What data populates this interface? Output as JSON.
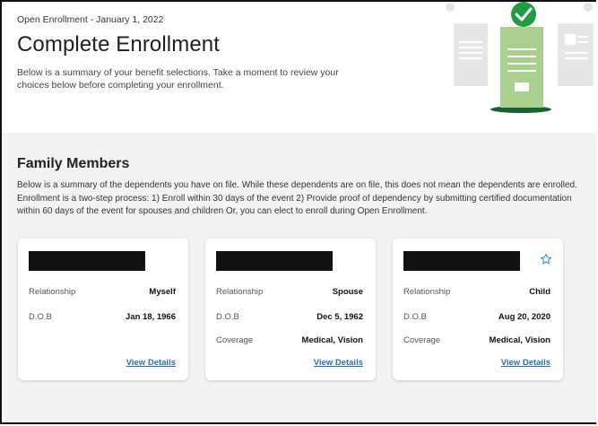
{
  "header": {
    "eyebrow": "Open Enrollment - January 1, 2022",
    "title": "Complete Enrollment",
    "intro": "Below is a summary of your benefit selections. Take a moment to review your choices below before completing your enrollment."
  },
  "family": {
    "title": "Family Members",
    "desc_lines": [
      "Below is a summary of the dependents you have on file. While these dependents are on file, this does not mean the dependents are enrolled.",
      "Enrollment is a two-step process: 1) Enroll within 30 days of the event 2) Provide proof of dependency by submitting certified documentation",
      "within 60 days of the event for spouses and children Or, you can elect to enroll during Open Enrollment."
    ],
    "cards": [
      {
        "relationship_label": "Relationship",
        "relationship": "Myself",
        "dob_label": "D.O.B",
        "dob": "Jan 18, 1966",
        "link": "View Details"
      },
      {
        "relationship_label": "Relationship",
        "relationship": "Spouse",
        "dob_label": "D.O.B",
        "dob": "Dec 5, 1962",
        "coverage_label": "Coverage",
        "coverage": "Medical, Vision",
        "link": "View Details"
      },
      {
        "relationship_label": "Relationship",
        "relationship": "Child",
        "dob_label": "D.O.B",
        "dob": "Aug 20, 2020",
        "coverage_label": "Coverage",
        "coverage": "Medical, Vision",
        "link": "View Details"
      }
    ]
  },
  "colors": {
    "accent_green": "#1e9e3e",
    "doc_green": "#a9d08e",
    "link_blue": "#2c6fb5",
    "section_bg": "#f2f4f3"
  },
  "icons": [
    "checkmark-icon",
    "star-outline-icon"
  ]
}
